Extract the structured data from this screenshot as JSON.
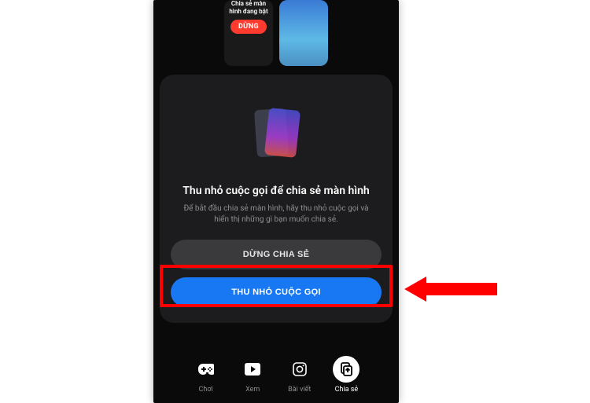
{
  "thumbs": {
    "screen_share_text": "Chia sẻ màn hình đang bật",
    "stop_pill": "DỪNG"
  },
  "sheet": {
    "title": "Thu nhỏ cuộc gọi để chia sẻ màn hình",
    "subtitle": "Để bắt đầu chia sẻ màn hình, hãy thu nhỏ cuộc gọi và hiển thị những gì bạn muốn chia sẻ.",
    "stop_button": "DỪNG CHIA SẺ",
    "minimize_button": "THU NHỎ CUỘC GỌI"
  },
  "nav": {
    "items": [
      {
        "label": "Chơi"
      },
      {
        "label": "Xem"
      },
      {
        "label": "Bài viết"
      },
      {
        "label": "Chia sẻ"
      }
    ]
  }
}
